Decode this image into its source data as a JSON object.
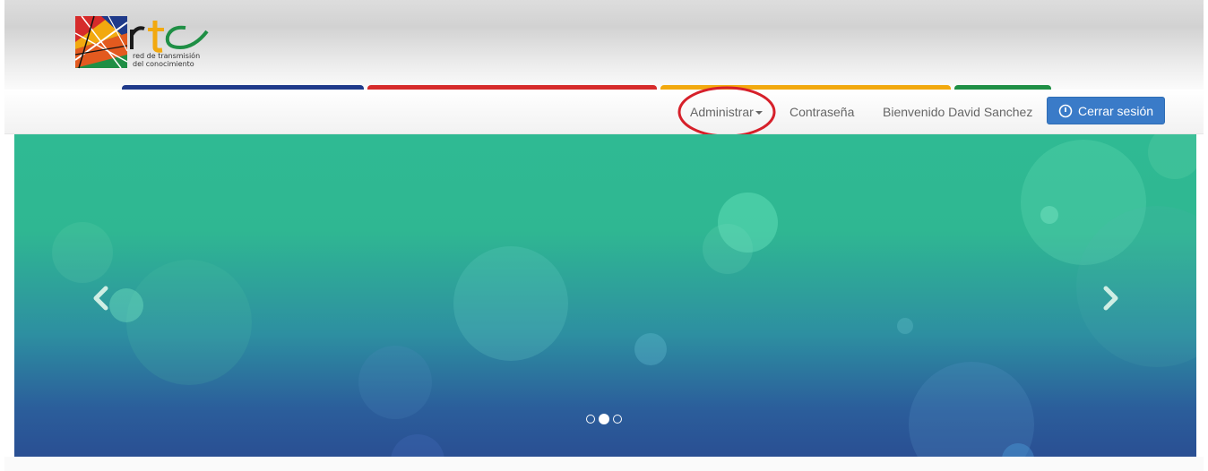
{
  "logo": {
    "letters": "rtc",
    "subtitle_line1": "red de transmisión",
    "subtitle_line2": "del conocimiento"
  },
  "colors": {
    "tab_blue": "#1f3a8a",
    "tab_red": "#d62b2b",
    "tab_yellow": "#f2a90f",
    "tab_green": "#1f8f45",
    "button_blue": "#3a7bc8",
    "annotation_red": "#d6202a"
  },
  "nav": {
    "administrar": "Administrar",
    "contrasena": "Contraseña",
    "welcome": "Bienvenido David Sanchez",
    "logout": "Cerrar sesión"
  },
  "icons": {
    "logout": "power-icon",
    "prev": "chevron-left-icon",
    "next": "chevron-right-icon",
    "dropdown": "caret-down-icon"
  },
  "carousel": {
    "slide_count": 3,
    "active_index": 1
  }
}
